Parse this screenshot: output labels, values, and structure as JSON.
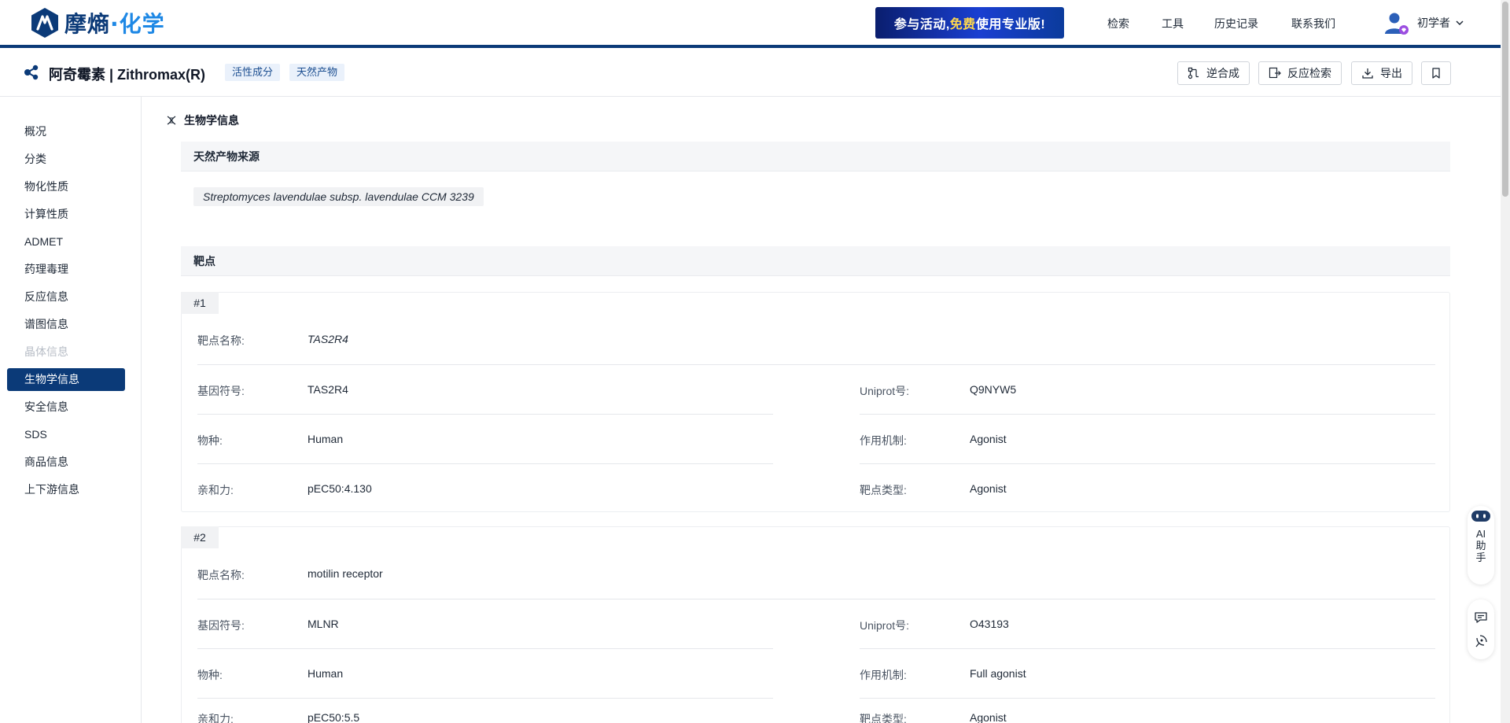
{
  "header": {
    "brand_name": "摩熵",
    "brand_accent": "化学",
    "brand_dot": "·",
    "promo_part1": "参与活动,",
    "promo_highlight": "免费",
    "promo_part2": "使用专业版!",
    "nav": [
      "检索",
      "工具",
      "历史记录",
      "联系我们"
    ],
    "user_name": "初学者"
  },
  "compound": {
    "title": "阿奇霉素 | Zithromax(R)",
    "tags": [
      "活性成分",
      "天然产物"
    ],
    "actions": {
      "retro": "逆合成",
      "reaction_search": "反应检索",
      "export": "导出"
    }
  },
  "sidebar": {
    "items": [
      {
        "label": "概况",
        "state": "normal"
      },
      {
        "label": "分类",
        "state": "normal"
      },
      {
        "label": "物化性质",
        "state": "normal"
      },
      {
        "label": "计算性质",
        "state": "normal"
      },
      {
        "label": "ADMET",
        "state": "normal"
      },
      {
        "label": "药理毒理",
        "state": "normal"
      },
      {
        "label": "反应信息",
        "state": "normal"
      },
      {
        "label": "谱图信息",
        "state": "normal"
      },
      {
        "label": "晶体信息",
        "state": "disabled"
      },
      {
        "label": "生物学信息",
        "state": "active"
      },
      {
        "label": "安全信息",
        "state": "normal"
      },
      {
        "label": "SDS",
        "state": "normal"
      },
      {
        "label": "商品信息",
        "state": "normal"
      },
      {
        "label": "上下游信息",
        "state": "normal"
      }
    ]
  },
  "main": {
    "section_title": "生物学信息",
    "natural_source_title": "天然产物来源",
    "natural_source_value": "Streptomyces lavendulae subsp. lavendulae CCM 3239",
    "targets_title": "靶点",
    "labels": {
      "target_name": "靶点名称:",
      "gene_symbol": "基因符号:",
      "uniprot": "Uniprot号:",
      "species": "物种:",
      "mechanism": "作用机制:",
      "affinity": "亲和力:",
      "target_type": "靶点类型:"
    },
    "targets": [
      {
        "badge": "#1",
        "target_name": "TAS2R4",
        "gene_symbol": "TAS2R4",
        "uniprot": "Q9NYW5",
        "species": "Human",
        "mechanism": "Agonist",
        "affinity": "pEC50:4.130",
        "target_type": "Agonist"
      },
      {
        "badge": "#2",
        "target_name": "motilin receptor",
        "gene_symbol": "MLNR",
        "uniprot": "O43193",
        "species": "Human",
        "mechanism": "Full agonist",
        "affinity": "pEC50:5.5",
        "target_type": "Agonist"
      }
    ]
  },
  "floaters": {
    "ai_label": "AI助手"
  },
  "colors": {
    "primary": "#0b3a78",
    "accent": "#1e88e5",
    "tag_bg": "#eaf1fb",
    "sub_head_bg": "#f5f6f8"
  }
}
